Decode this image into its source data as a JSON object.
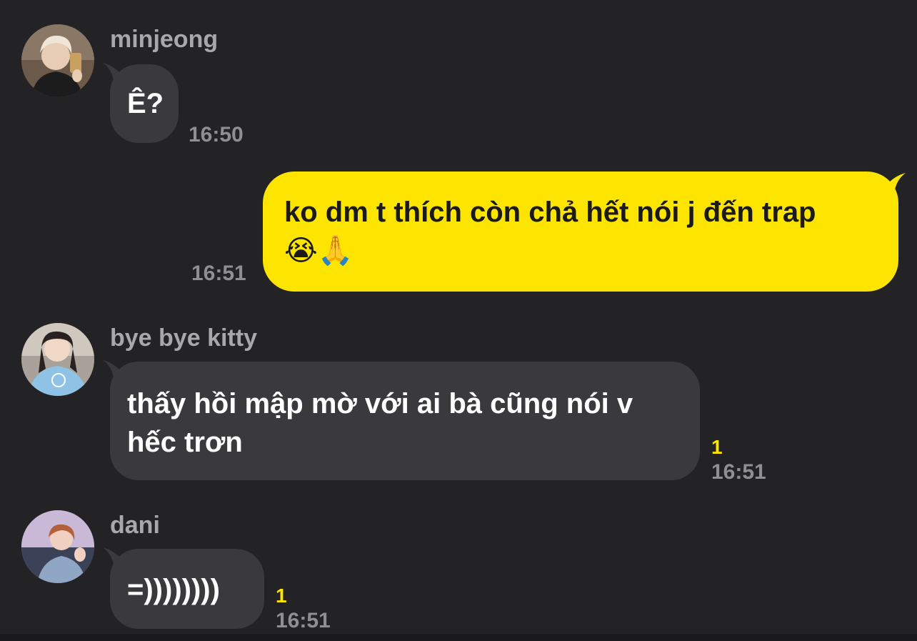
{
  "messages": [
    {
      "sender": "minjeong",
      "text": "Ê?",
      "time": "16:50",
      "avatar_icon": "person-selfie-avatar"
    },
    {
      "direction": "outgoing",
      "text_line1": "ko dm t thích còn chả hết nói j đến trap",
      "emoji": "😭🙏",
      "time": "16:51"
    },
    {
      "sender": "bye bye kitty",
      "text_line1": "thấy hồi mập mờ với ai bà cũng nói v",
      "text_line2": "hếc trơn",
      "unread": "1",
      "time": "16:51",
      "avatar_icon": "person-blue-shirt-avatar"
    },
    {
      "sender": "dani",
      "text": "=))))))))",
      "unread": "1",
      "time": "16:51",
      "avatar_icon": "person-waving-avatar"
    }
  ],
  "colors": {
    "background": "#232325",
    "incoming_bubble": "#3a3a3c",
    "outgoing_bubble": "#fee500",
    "unread": "#fee500"
  }
}
